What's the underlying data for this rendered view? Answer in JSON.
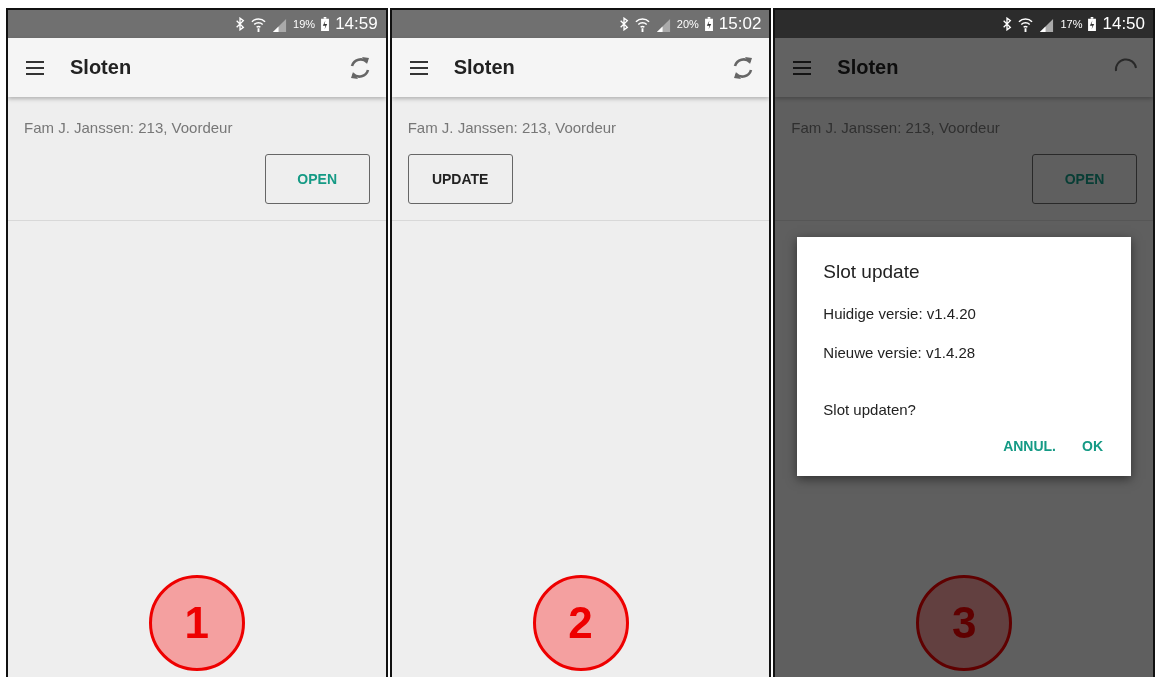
{
  "screens": [
    {
      "step": "1",
      "status": {
        "battery": "19%",
        "time": "14:59"
      },
      "toolbar": {
        "title": "Sloten",
        "busy": false
      },
      "lock": {
        "label": "Fam J. Janssen: 213, Voordeur",
        "button": {
          "label": "OPEN",
          "kind": "open"
        }
      }
    },
    {
      "step": "2",
      "status": {
        "battery": "20%",
        "time": "15:02"
      },
      "toolbar": {
        "title": "Sloten",
        "busy": false
      },
      "lock": {
        "label": "Fam J. Janssen: 213, Voordeur",
        "button": {
          "label": "UPDATE",
          "kind": "update"
        }
      }
    },
    {
      "step": "3",
      "status": {
        "battery": "17%",
        "time": "14:50"
      },
      "toolbar": {
        "title": "Sloten",
        "busy": true
      },
      "lock": {
        "label": "Fam J. Janssen: 213, Voordeur",
        "button": {
          "label": "OPEN",
          "kind": "open"
        }
      },
      "dialog": {
        "title": "Slot update",
        "lines": [
          "Huidige versie: v1.4.20",
          "Nieuwe versie: v1.4.28"
        ],
        "question": "Slot updaten?",
        "actions": [
          "ANNUL.",
          "OK"
        ]
      }
    }
  ]
}
